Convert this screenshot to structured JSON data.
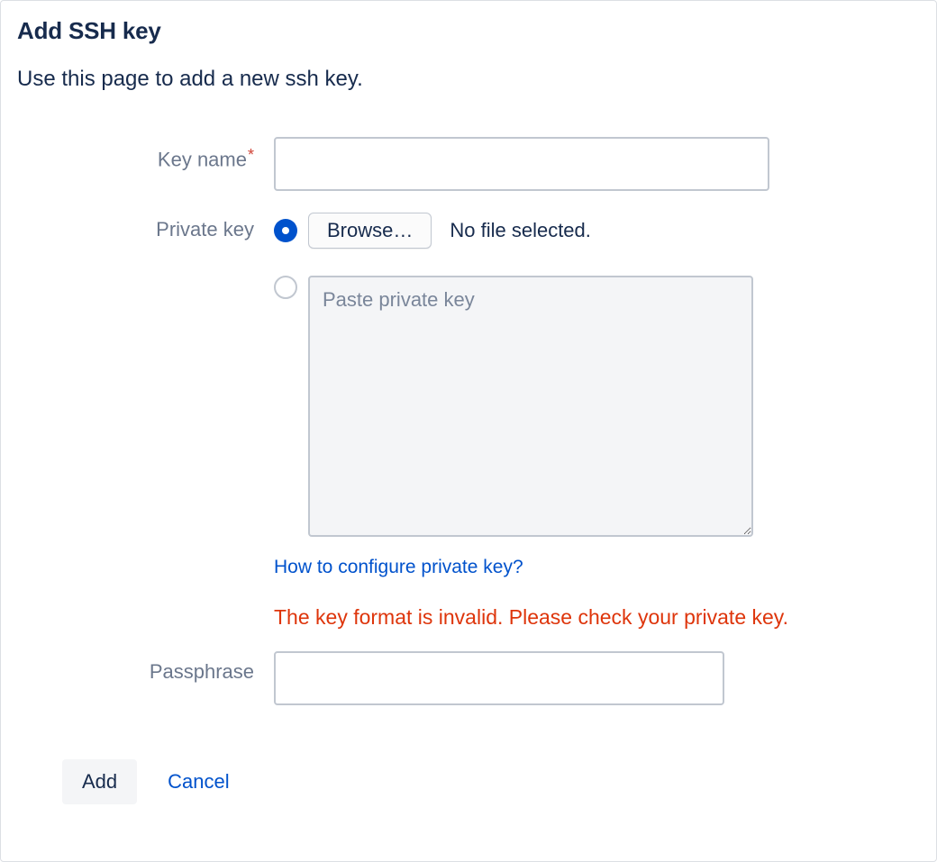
{
  "header": {
    "title": "Add SSH key",
    "subtitle": "Use this page to add a new ssh key."
  },
  "form": {
    "key_name": {
      "label": "Key name",
      "required_marker": "*",
      "value": ""
    },
    "private_key": {
      "label": "Private key",
      "browse_label": "Browse…",
      "no_file_text": "No file selected.",
      "paste_placeholder": "Paste private key",
      "paste_value": "",
      "help_link": "How to configure private key?",
      "error": "The key format is invalid. Please check your private key."
    },
    "passphrase": {
      "label": "Passphrase",
      "value": ""
    }
  },
  "actions": {
    "add": "Add",
    "cancel": "Cancel"
  }
}
